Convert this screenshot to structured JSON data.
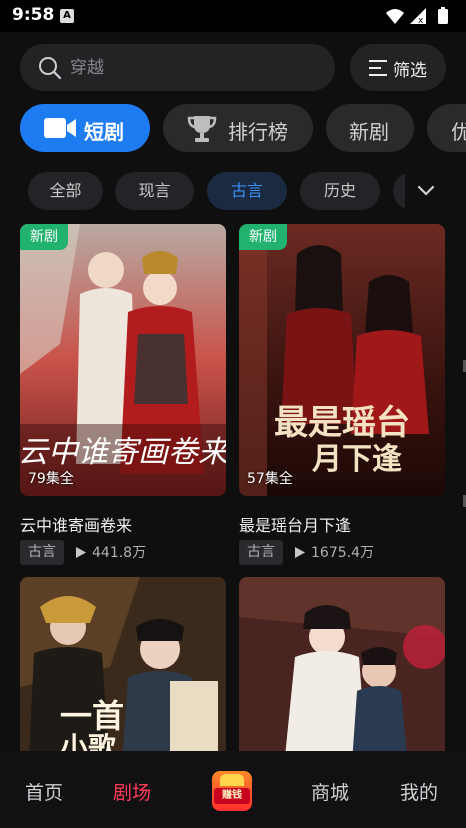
{
  "status_bar": {
    "time": "9:58",
    "badge": "A"
  },
  "search": {
    "placeholder": "穿越"
  },
  "filter": {
    "label": "筛选"
  },
  "categories": [
    {
      "label": "短剧",
      "icon": "video-camera-icon",
      "active": true
    },
    {
      "label": "排行榜",
      "icon": "trophy-icon",
      "active": false
    },
    {
      "label": "新剧",
      "active": false
    },
    {
      "label": "优",
      "active": false
    }
  ],
  "genres": [
    {
      "label": "全部",
      "active": false
    },
    {
      "label": "现言",
      "active": false
    },
    {
      "label": "古言",
      "active": true
    },
    {
      "label": "历史",
      "active": false
    }
  ],
  "dramas": [
    {
      "badge": "新剧",
      "episodes": "79集全",
      "title": "云中谁寄画卷来",
      "genre": "古言",
      "views": "441.8万",
      "poster_text": "云中谁寄画卷来"
    },
    {
      "badge": "新剧",
      "episodes": "57集全",
      "title": "最是瑶台月下逢",
      "genre": "古言",
      "views": "1675.4万",
      "poster_text": "最是瑶台月下逢"
    },
    {
      "poster_text": "一首小歌"
    },
    {
      "poster_text": ""
    }
  ],
  "bottom_nav": {
    "home": "首页",
    "theater": "剧场",
    "earn": "赚钱",
    "mall": "商城",
    "mine": "我的"
  },
  "colors": {
    "accent": "#1e7cf3",
    "active_nav": "#ff3b58",
    "new_badge": "#21b26f"
  }
}
